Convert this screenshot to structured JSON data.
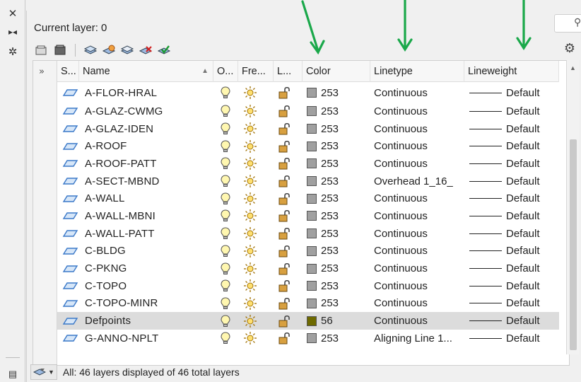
{
  "current_layer": {
    "label": "Current layer: 0"
  },
  "columns": {
    "status": "S...",
    "name": "Name",
    "on": "O...",
    "freeze": "Fre...",
    "lock": "L...",
    "color": "Color",
    "linetype": "Linetype",
    "lineweight": "Lineweight"
  },
  "layers": [
    {
      "name": "A-FLOR-HRAL",
      "color_index": "253",
      "color_hex": "#a0a0a0",
      "linetype": "Continuous",
      "lineweight": "Default"
    },
    {
      "name": "A-GLAZ-CWMG",
      "color_index": "253",
      "color_hex": "#a0a0a0",
      "linetype": "Continuous",
      "lineweight": "Default"
    },
    {
      "name": "A-GLAZ-IDEN",
      "color_index": "253",
      "color_hex": "#a0a0a0",
      "linetype": "Continuous",
      "lineweight": "Default"
    },
    {
      "name": "A-ROOF",
      "color_index": "253",
      "color_hex": "#a0a0a0",
      "linetype": "Continuous",
      "lineweight": "Default"
    },
    {
      "name": "A-ROOF-PATT",
      "color_index": "253",
      "color_hex": "#a0a0a0",
      "linetype": "Continuous",
      "lineweight": "Default"
    },
    {
      "name": "A-SECT-MBND",
      "color_index": "253",
      "color_hex": "#a0a0a0",
      "linetype": "Overhead 1_16_",
      "lineweight": "Default"
    },
    {
      "name": "A-WALL",
      "color_index": "253",
      "color_hex": "#a0a0a0",
      "linetype": "Continuous",
      "lineweight": "Default"
    },
    {
      "name": "A-WALL-MBNI",
      "color_index": "253",
      "color_hex": "#a0a0a0",
      "linetype": "Continuous",
      "lineweight": "Default"
    },
    {
      "name": "A-WALL-PATT",
      "color_index": "253",
      "color_hex": "#a0a0a0",
      "linetype": "Continuous",
      "lineweight": "Default"
    },
    {
      "name": "C-BLDG",
      "color_index": "253",
      "color_hex": "#a0a0a0",
      "linetype": "Continuous",
      "lineweight": "Default"
    },
    {
      "name": "C-PKNG",
      "color_index": "253",
      "color_hex": "#a0a0a0",
      "linetype": "Continuous",
      "lineweight": "Default"
    },
    {
      "name": "C-TOPO",
      "color_index": "253",
      "color_hex": "#a0a0a0",
      "linetype": "Continuous",
      "lineweight": "Default"
    },
    {
      "name": "C-TOPO-MINR",
      "color_index": "253",
      "color_hex": "#a0a0a0",
      "linetype": "Continuous",
      "lineweight": "Default"
    },
    {
      "name": "Defpoints",
      "color_index": "56",
      "color_hex": "#6e6a00",
      "linetype": "Continuous",
      "lineweight": "Default",
      "selected": true
    },
    {
      "name": "G-ANNO-NPLT",
      "color_index": "253",
      "color_hex": "#a0a0a0",
      "linetype": "Aligning Line 1...",
      "lineweight": "Default"
    }
  ],
  "status_bar": {
    "text": "All: 46 layers displayed of 46 total layers"
  },
  "colors": {
    "arrow_green": "#1aa84a",
    "selection_bg": "#dcdcdc",
    "layer_icon_blue": "#3a78c8"
  },
  "icons": {
    "left_strip": [
      "close-icon",
      "pin-icon",
      "settings-icon",
      "layers-icon"
    ],
    "toolbar": [
      "layer-states-icon",
      "layer-filter-icon",
      "new-layer-icon",
      "new-vp-frozen-layer-icon",
      "new-group-filter-icon",
      "delete-layer-icon",
      "set-current-icon"
    ],
    "row": [
      "layer-status-icon",
      "lightbulb-on-icon",
      "sun-thawed-icon",
      "lock-unlocked-icon"
    ]
  }
}
